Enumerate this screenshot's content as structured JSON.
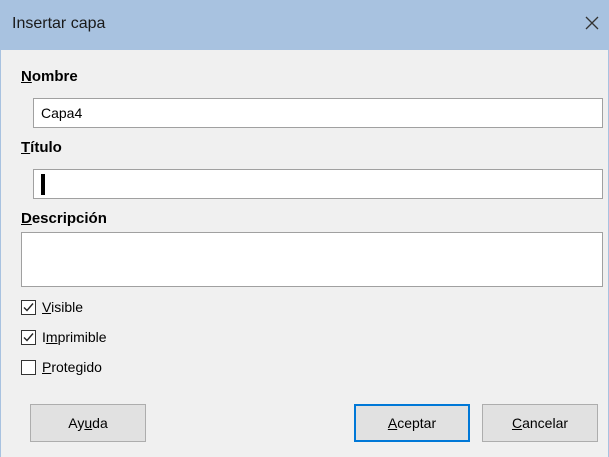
{
  "window": {
    "title": "Insertar capa",
    "close_glyph": "✕"
  },
  "form": {
    "name_label_accel": "N",
    "name_label_rest": "ombre",
    "name_value": "Capa4",
    "title_label_accel": "T",
    "title_label_rest": "ítulo",
    "title_value": "",
    "description_label_accel": "D",
    "description_label_rest": "escripción",
    "description_value": ""
  },
  "checkboxes": {
    "visible": {
      "accel": "V",
      "rest": "isible",
      "checked": true
    },
    "printable": {
      "pre": "I",
      "accel": "m",
      "rest": "primible",
      "checked": true
    },
    "protected": {
      "accel": "P",
      "rest": "rotegido",
      "checked": false
    }
  },
  "buttons": {
    "help_pre": "Ay",
    "help_accel": "u",
    "help_rest": "da",
    "ok_accel": "A",
    "ok_rest": "ceptar",
    "cancel_accel": "C",
    "cancel_rest": "ancelar"
  },
  "colors": {
    "titlebar": "#a8c2e0",
    "primary_border": "#0078d7"
  },
  "icons": {
    "close": "close-icon",
    "check": "checkmark-icon"
  }
}
